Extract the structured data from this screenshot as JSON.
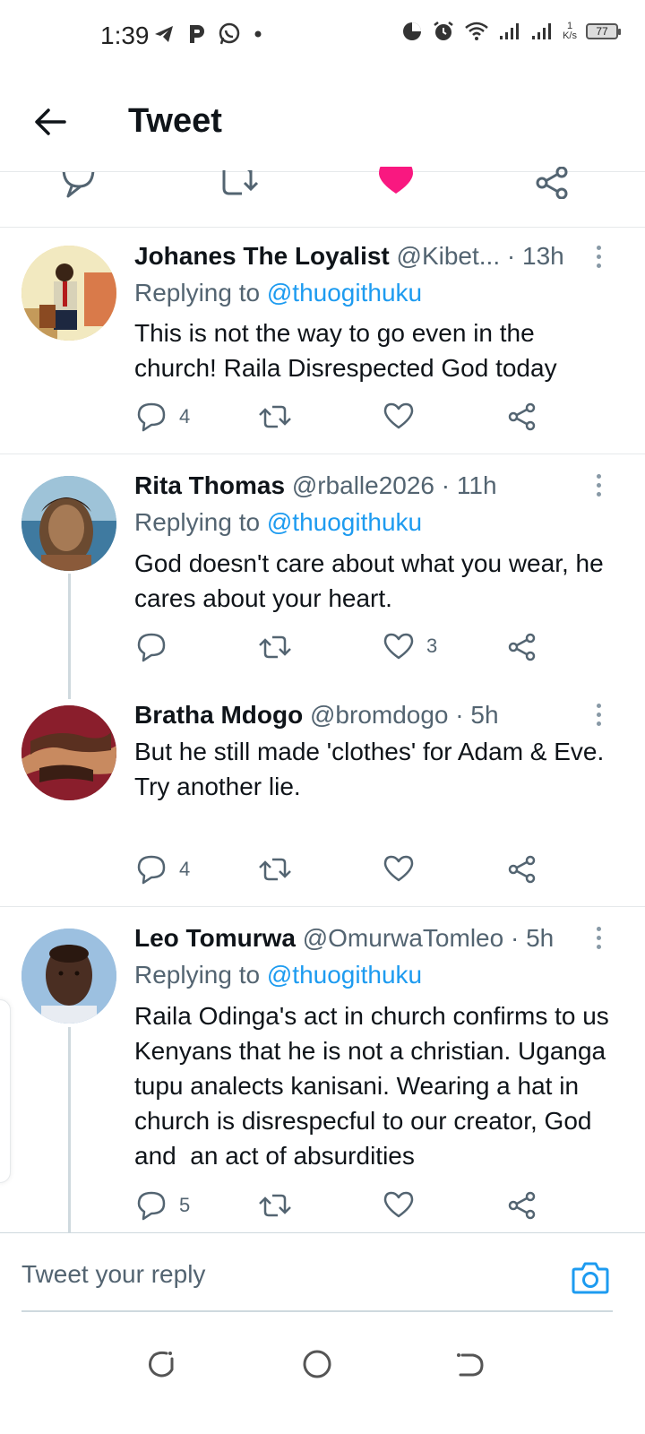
{
  "status_bar": {
    "time": "1:39",
    "speed_value": "1",
    "speed_unit": "K/s",
    "battery": "77",
    "left_icons": [
      "telegram-icon",
      "p-icon",
      "whatsapp-icon",
      "dot-icon"
    ],
    "right_icons": [
      "data-saver-icon",
      "alarm-icon",
      "wifi-icon",
      "signal-icon",
      "signal-icon"
    ]
  },
  "header": {
    "title": "Tweet"
  },
  "main_tweet_actions": {
    "icons": [
      "reply-icon",
      "retweet-icon",
      "like-filled-icon",
      "share-icon"
    ],
    "like_color": "#f91880"
  },
  "replies": [
    {
      "name": "Johanes The Loyalist",
      "handle": "@Kibet...",
      "time": " · 13h",
      "replying_label": "Replying to ",
      "replying_to": "@thuogithuku",
      "text": "This is not the way to go even in the church! Raila Disrespected God today",
      "reply_count": "4",
      "retweet_count": "",
      "like_count": ""
    },
    {
      "name": "Rita Thomas",
      "handle": "@rballe2026",
      "time": " · 11h",
      "replying_label": "Replying to ",
      "replying_to": "@thuogithuku",
      "text": "God doesn't care about what you wear, he cares about your heart.",
      "reply_count": "",
      "retweet_count": "",
      "like_count": "3"
    },
    {
      "name": "Bratha Mdogo",
      "handle": "@bromdogo",
      "time": " · 5h",
      "text": "But he still made 'clothes' for Adam & Eve.\nTry another lie.",
      "reply_count": "4",
      "retweet_count": "",
      "like_count": ""
    },
    {
      "name": "Leo Tomurwa",
      "handle": "@OmurwaTomleo",
      "time": " · 5h",
      "replying_label": "Replying to ",
      "replying_to": "@thuogithuku",
      "text": "Raila Odinga's act in church confirms to us Kenyans that he is not a christian. Uganga tupu analects kanisani. Wearing a hat in church is disrespecful to our creator, God and  an act of absurdities",
      "reply_count": "5",
      "retweet_count": "",
      "like_count": ""
    }
  ],
  "reply_bar": {
    "placeholder": "Tweet your reply",
    "camera_icon": "camera-icon",
    "accent": "#1d9bf0"
  },
  "nav_bar": {
    "icons": [
      "recents-icon",
      "home-icon",
      "back-nav-icon"
    ]
  }
}
